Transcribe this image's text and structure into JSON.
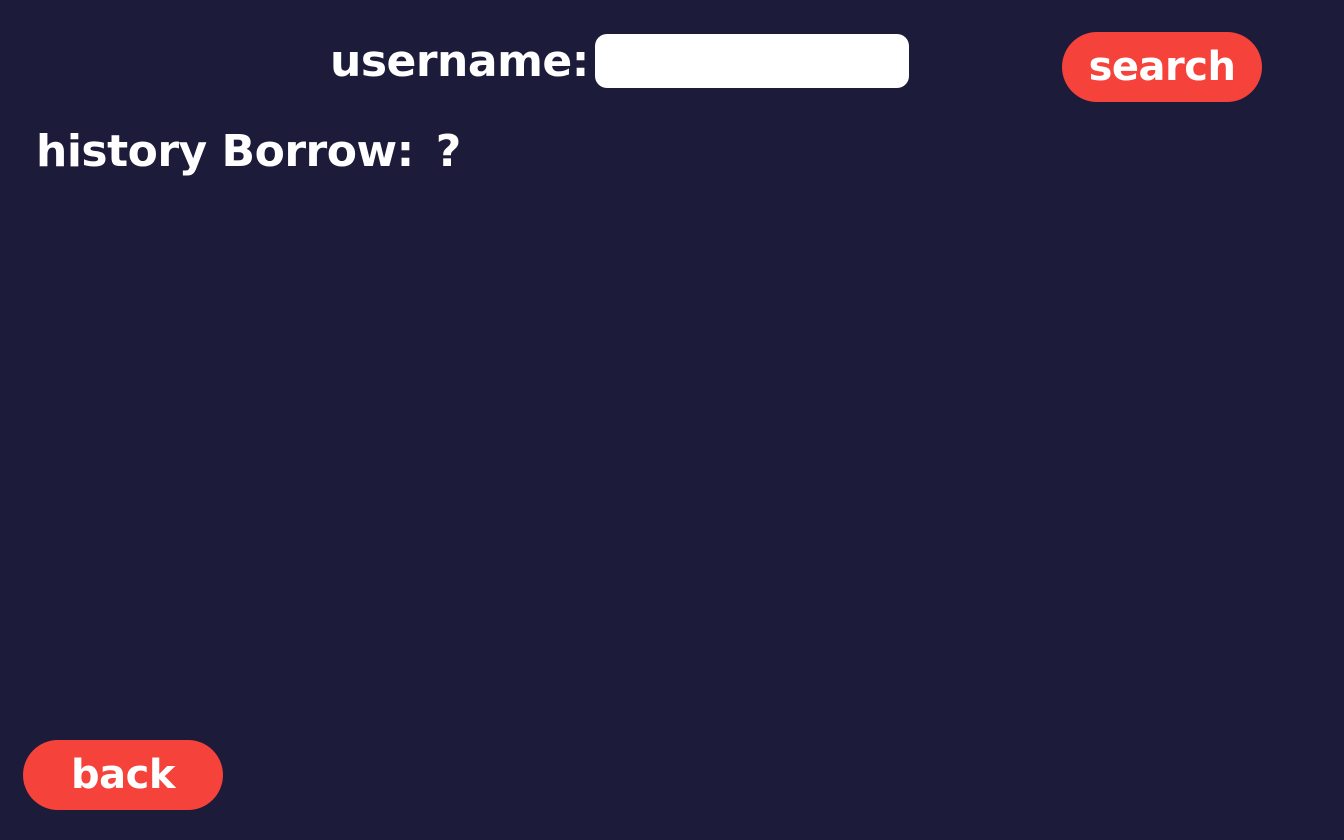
{
  "search_form": {
    "username_label": "username:",
    "username_value": "",
    "username_placeholder": "",
    "search_label": "search"
  },
  "history": {
    "label": "history Borrow:",
    "value": "?"
  },
  "navigation": {
    "back_label": "back"
  },
  "colors": {
    "background": "#1c1b3a",
    "button": "#f5423a",
    "text": "#ffffff",
    "input": "#ffffff"
  }
}
